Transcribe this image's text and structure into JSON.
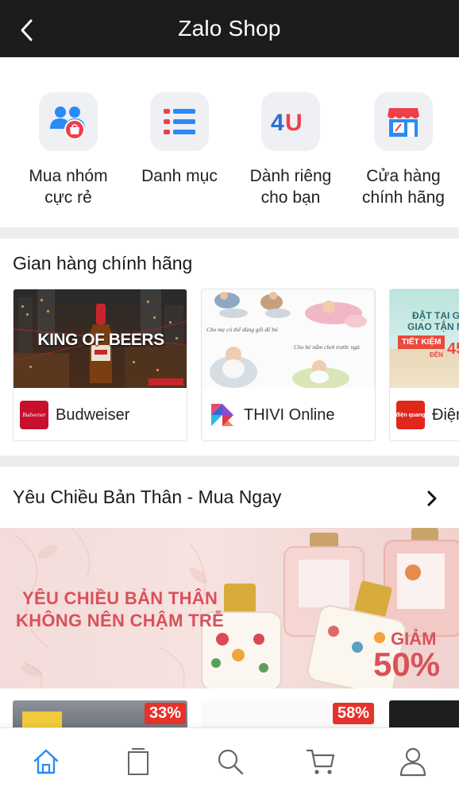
{
  "header": {
    "title": "Zalo Shop"
  },
  "quick_actions": [
    {
      "line1": "Mua nhóm",
      "line2": "cực rẻ",
      "icon": "group-buy-icon"
    },
    {
      "line1": "Danh mục",
      "line2": "",
      "icon": "list-icon"
    },
    {
      "line1": "Dành riêng",
      "line2": "cho bạn",
      "icon": "for-you-icon"
    },
    {
      "line1": "Cửa hàng",
      "line2": "chính hãng",
      "icon": "store-icon"
    }
  ],
  "official_stores": {
    "title": "Gian hàng chính hãng",
    "items": [
      {
        "name": "Budweiser",
        "banner_text": "KING OF BEERS",
        "logo_text": "Budweiser"
      },
      {
        "name": "THIVI Online",
        "caption_1": "Cho mẹ có thể dùng gối để bú",
        "caption_2": "Cho bé nằm chơi trước ngủ"
      },
      {
        "name": "Điện",
        "logo_text": "điện quang",
        "banner_line1": "ĐẶT TẠI G",
        "banner_line2": "GIAO TẬN N",
        "tag": "TIẾT KIỆM",
        "tag_small": "ĐẾN",
        "tag_num": "45"
      }
    ]
  },
  "beauty": {
    "title": "Yêu Chiều Bản Thân - Mua Ngay",
    "banner_line1": "YÊU CHIỀU BẢN THÂN",
    "banner_line2": "KHÔNG NÊN CHẬM TRỄ",
    "discount_label": "GIẢM",
    "discount_value": "50%"
  },
  "deals": [
    {
      "badge": "33%"
    },
    {
      "badge": "58%"
    },
    {
      "badge": ""
    }
  ],
  "bottom_nav": [
    {
      "icon": "home-icon",
      "active": true
    },
    {
      "icon": "orders-icon",
      "active": false
    },
    {
      "icon": "search-icon",
      "active": false
    },
    {
      "icon": "cart-icon",
      "active": false
    },
    {
      "icon": "profile-icon",
      "active": false
    }
  ],
  "colors": {
    "header_bg": "#1c1c1c",
    "accent_blue": "#2a8af6",
    "promo_red": "#d9515b",
    "badge_red": "#e5322b"
  }
}
